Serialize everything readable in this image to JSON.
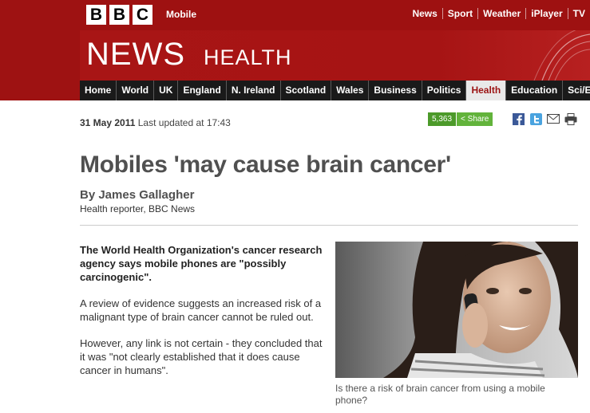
{
  "top": {
    "logo_letters": [
      "B",
      "B",
      "C"
    ],
    "mobile_label": "Mobile",
    "links": [
      "News",
      "Sport",
      "Weather",
      "iPlayer",
      "TV"
    ]
  },
  "banner": {
    "news": "NEWS",
    "section": "HEALTH"
  },
  "nav": {
    "items": [
      "Home",
      "World",
      "UK",
      "England",
      "N. Ireland",
      "Scotland",
      "Wales",
      "Business",
      "Politics",
      "Health",
      "Education",
      "Sci/Env"
    ],
    "active": "Health"
  },
  "article": {
    "date": "31 May 2011",
    "updated": "Last updated at 17:43",
    "share_count": "5,363",
    "share_label": "Share",
    "headline": "Mobiles 'may cause brain cancer'",
    "author": "By James Gallagher",
    "role": "Health reporter, BBC News",
    "paragraphs": [
      "The World Health Organization's cancer research agency says mobile phones are \"possibly carcinogenic\".",
      "A review of evidence suggests an increased risk of a malignant type of brain cancer cannot be ruled out.",
      "However, any link is not certain - they concluded that it was \"not clearly established that it does cause cancer in humans\"."
    ],
    "caption": "Is there a risk of brain cancer from using a mobile phone?"
  },
  "icons": [
    "share-icon",
    "facebook-icon",
    "twitter-icon",
    "email-icon",
    "print-icon"
  ],
  "colors": {
    "brand_red": "#9e1212",
    "nav_bg": "#1a1a1a",
    "share_green": "#62b33b"
  }
}
